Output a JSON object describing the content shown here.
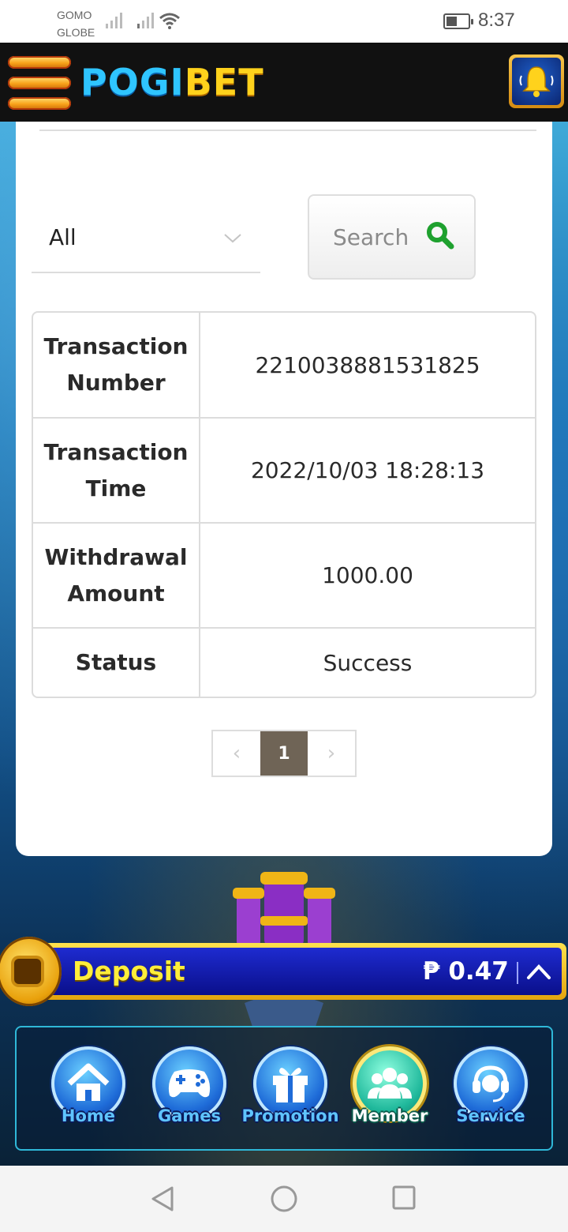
{
  "status_bar": {
    "carriers": [
      "GOMO",
      "GLOBE"
    ],
    "time": "8:37"
  },
  "header": {
    "logo_part1": "POGI",
    "logo_part2": "BET",
    "menu_icon": "hamburger-menu-icon",
    "bell_icon": "bell-icon"
  },
  "filter": {
    "selected": "All",
    "chevron_icon": "chevron-down-icon"
  },
  "search": {
    "label": "Search",
    "icon": "search-icon"
  },
  "transaction": {
    "rows": [
      {
        "label": "Transaction Number",
        "value": "2210038881531825"
      },
      {
        "label": "Transaction Time",
        "value": "2022/10/03 18:28:13"
      },
      {
        "label": "Withdrawal Amount",
        "value": "1000.00"
      },
      {
        "label": "Status",
        "value": "Success"
      }
    ]
  },
  "pager": {
    "prev": "‹",
    "current": "1",
    "next": "›"
  },
  "deposit_bar": {
    "label": "Deposit",
    "balance": "₱ 0.47"
  },
  "bottom_nav": {
    "items": [
      {
        "label": "Home",
        "icon": "home-icon"
      },
      {
        "label": "Games",
        "icon": "gamepad-icon"
      },
      {
        "label": "Promotion",
        "icon": "gift-icon"
      },
      {
        "label": "Member",
        "icon": "users-icon"
      },
      {
        "label": "Service",
        "icon": "headset-icon"
      }
    ],
    "active": "Member"
  },
  "colors": {
    "header_bg": "#111111",
    "accent_gold": "#ffd21c",
    "logo_blue": "#2fc5ff",
    "pager_active": "#6f6456",
    "search_icon_green": "#1fa12f"
  }
}
